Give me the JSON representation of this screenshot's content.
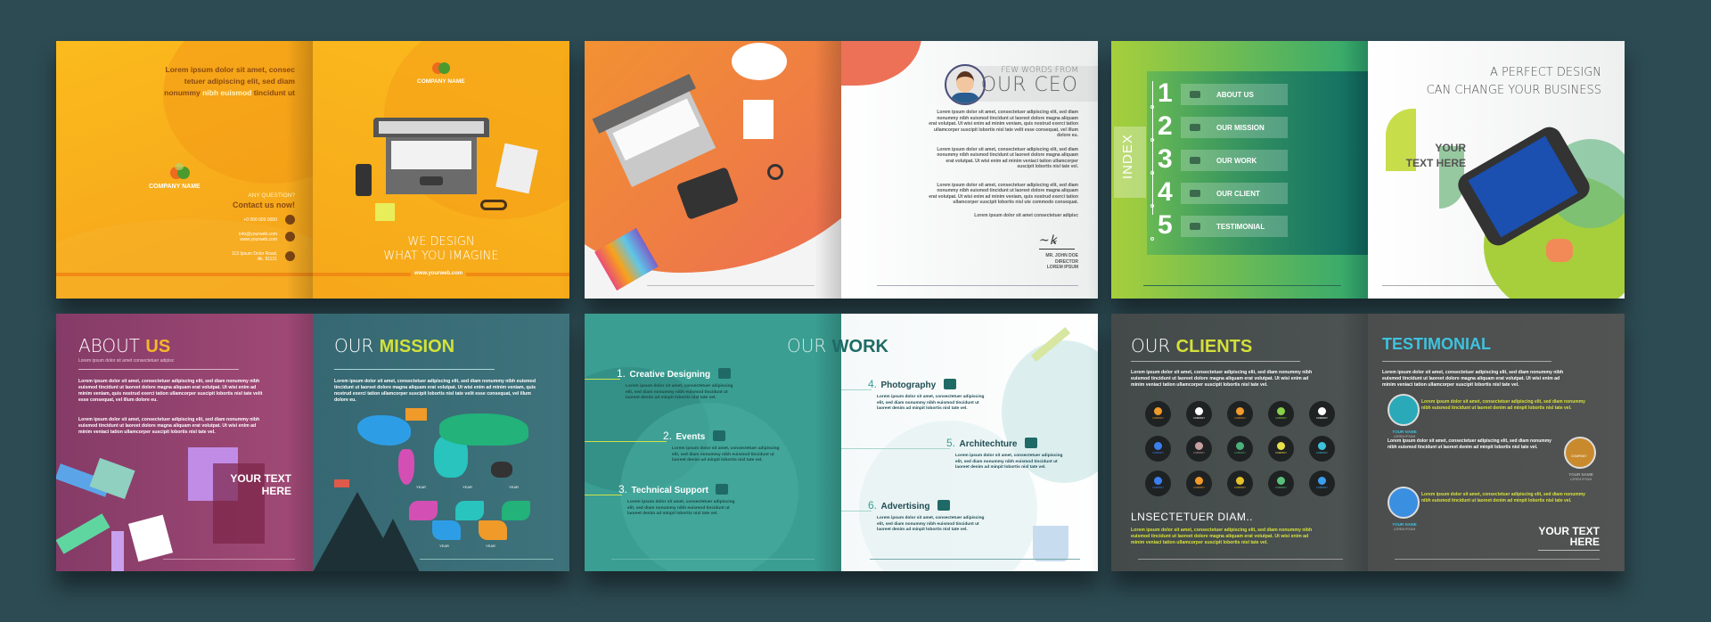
{
  "spread1": {
    "back": {
      "intro_a": "Lorem ipsum dolor sit amet, consec",
      "intro_b": "tetuer adipiscing elit, sed diam",
      "intro_c1": "nonummy ",
      "intro_highlight": "nibh euismod",
      "intro_c2": " tincidunt ut",
      "company": "COMPANY NAME",
      "question": "ANY QUESTION?",
      "contact": "Contact us now!",
      "phone": "+0 000 000 0000",
      "email": "info@yourweb.com",
      "web": "www.yourweb.com",
      "address_1": "113 Ipsum Dolor Road,",
      "address_2": "Ak. 91131"
    },
    "front": {
      "company": "COMPANY NAME",
      "tagline_1": "WE DESIGN",
      "tagline_2": "WHAT YOU IMAGINE",
      "url": "www.yourweb.com"
    }
  },
  "spread2": {
    "ceo": {
      "kicker": "FEW WORDS FROM",
      "title": "OUR CEO",
      "paragraphs": [
        "Lorem ipsum dolor sit amet, consectetuer adipiscing elit, sed diam nonummy nibh euismod tincidunt ut laoreet dolore magna aliquam erat volutpat. Ut wisi enim ad minim veniam, quis nostrud exerci tation ullamcorper suscipit lobortis nisl tate velit esse consequat, vel illum dolore eu.",
        "Lorem ipsum dolor sit amet, consectetuer adipiscing elit, sed diam nonummy nibh euismod tincidunt ut laoreet dolore magna aliquam erat volutpat. Ut wisi enim ad minim veniaci tation ullamcorper suscipit lobortis nisl tate vel.",
        "Lorem ipsum dolor sit amet, consectetuer adipiscing elit, sed diam nonummy nibh euismod tincidunt ut laoreet dolore magna aliquam erat volutpat. Ut wisi enim ad minim veniam, quis nostrud exerci tation ullamcorper suscipit lobortis nisl ute commodo consequat.",
        "Lorem ipsum dolor sit amet consectetuer adipisc"
      ],
      "name": "MR. JOHN DOE",
      "role": "DIRECTOR",
      "org": "LOREM IPSUM"
    }
  },
  "spread3": {
    "index_label": "INDEX",
    "items": [
      {
        "num": "1",
        "label": "ABOUT US",
        "icon": "people-icon"
      },
      {
        "num": "2",
        "label": "OUR MISSION",
        "icon": "mountain-icon"
      },
      {
        "num": "3",
        "label": "OUR WORK",
        "icon": "document-icon"
      },
      {
        "num": "4",
        "label": "OUR CLIENT",
        "icon": "handshake-icon"
      },
      {
        "num": "5",
        "label": "TESTIMONIAL",
        "icon": "chat-icon"
      }
    ],
    "headline_1": "A PERFECT DESIGN",
    "headline_2": "CAN CHANGE YOUR BUSINESS",
    "quote_1": "YOUR",
    "quote_2": "TEXT HERE"
  },
  "spread4": {
    "about": {
      "title_a": "ABOUT ",
      "title_b": "US",
      "subtitle": "Lorem ipsum dolor sit amet consectetuer adipisc",
      "p1": "Lorem ipsum dolor sit amet, consectetuer adipiscing elit, sed diam nonummy nibh euismod tincidunt ut laoreet dolore magna aliquam erat volutpat. Ut wisi enim ad minim veniam, quis nostrud exerci tation ullamcorper suscipit lobortis nisl tate velit esse consequat, vel illum dolore eu.",
      "p2": "Lorem ipsum dolor sit amet, consectetuer adipiscing elit, sed diam nonummy nibh euismod tincidunt ut laoreet dolore magna aliquam erat volutpat. Ut wisi enim ad minim veniaci tation ullamcorper suscipit lobortis nisl tate vel.",
      "quote_1": "YOUR TEXT",
      "quote_2": "HERE"
    },
    "mission": {
      "title_a": "OUR ",
      "title_b": "MISSION",
      "p1": "Lorem ipsum dolor sit amet, consectetuer adipiscing elit, sed diam nonummy nibh euismod tincidunt ut laoreet dolore magna aliquam erat volutpat. Ut wisi enim ad minim veniam, quis nostrud exerci tation ullamcorper suscipit lobortis nisl tate velit esse consequat, vel illum dolore eu.",
      "timeline_label": "YEAR"
    }
  },
  "spread5": {
    "title_a": "OUR ",
    "title_b": "WORK",
    "items": [
      {
        "num": "1.",
        "label": "Creative Designing",
        "text": "Lorem ipsum dolor sit amet, consectetuer adipiscing elit, sed diam nonummy nibh euismod tincidunt ut laoreet denim ad minpit lobortis nisl tate vel."
      },
      {
        "num": "2.",
        "label": "Events",
        "text": "Lorem ipsum dolor sit amet, consectetuer adipiscing elit, sed diam nonummy nibh euismod tincidunt ut laoreet denim ad minpit lobortis nisl tate vel."
      },
      {
        "num": "3.",
        "label": "Technical Support",
        "text": "Lorem ipsum dolor sit amet, consectetuer adipiscing elit, sed diam nonummy nibh euismod tincidunt ut laoreet denim ad minpit lobortis nisl tate vel."
      },
      {
        "num": "4.",
        "label": "Photography",
        "text": "Lorem ipsum dolor sit amet, consectetuer adipiscing elit, sed diam nonummy nibh euismod tincidunt ut laoreet denim ad minpit lobortis nisl tate vel."
      },
      {
        "num": "5.",
        "label": "Architechture",
        "text": "Lorem ipsum dolor sit amet, consectetuer adipiscing elit, sed diam nonummy nibh euismod tincidunt ut laoreet denim ad minpit lobortis nisl tate vel."
      },
      {
        "num": "6.",
        "label": "Advertising",
        "text": "Lorem ipsum dolor sit amet, consectetuer adipiscing elit, sed diam nonummy nibh euismod tincidunt ut laoreet denim ad minpit lobortis nisl tate vel."
      }
    ]
  },
  "spread6": {
    "clients": {
      "title_a": "OUR ",
      "title_b": "CLIENTS",
      "p1": "Lorem ipsum dolor sit amet, consectetuer adipiscing elit, sed diam nonummy nibh euismod tincidunt ut laoreet dolore magna aliquam erat volutpat. Ut wisi enim ad minim veniaci tation ullamcorper suscipit lobortis nisl tate vel.",
      "logo_label": "COMPANY",
      "subheading": "LNSECTETUER DIAM..",
      "p2": "Lorem ipsum dolor sit amet, consectetuer adipiscing elit, sed diam nonummy nibh euismod tincidunt ut laoreet dolore magna aliquam erat volutpat. Ut wisi enim ad minim veniaci tation ullamcorper suscipit lobortis nisl tate vel."
    },
    "testimonial": {
      "title": "TESTIMONIAL",
      "p1": "Lorem ipsum dolor sit amet, consectetuer adipiscing elit, sed diam nonummy nibh euismod tincidunt ut laoreet dolore magna aliquam erat volutpat. Ut wisi enim ad minim veniaci tation ullamcorper suscipit lobortis nisl tate vel.",
      "entries": [
        {
          "name": "YOUR NAME",
          "sub": "LOREM IPSUM",
          "text": "Lorem ipsum dolor sit amet, consectetuer adipiscing elit, sed diam nonummy nibh euismod tincidunt ut laoreet denim ad minpit lobortis nisl tate vel."
        },
        {
          "name": "YOUR NAME",
          "sub": "LOREM IPSUM",
          "text": "Lorem ipsum dolor sit amet, consectetuer adipiscing elit, sed diam nonummy nibh euismod tincidunt ut laoreet denim ad minpit lobortis nisl tate vel."
        },
        {
          "name": "YOUR NAME",
          "sub": "LOREM IPSUM",
          "text": "Lorem ipsum dolor sit amet, consectetuer adipiscing elit, sed diam nonummy nibh euismod tincidunt ut laoreet denim ad minpit lobortis nisl tate vel."
        }
      ],
      "company": "COMPANY",
      "quote_1": "YOUR TEXT",
      "quote_2": "HERE"
    }
  },
  "colors": {
    "background": "#2d4b53",
    "orange": "#f6a81c",
    "green": "#9ccc3c",
    "teal": "#1f7a6e",
    "purple": "#8e3f6c",
    "slate": "#3a6670",
    "work_teal": "#3a9e92",
    "dark": "#474b4c",
    "accent_yellow": "#d7e23a",
    "accent_cyan": "#3ec3de"
  }
}
